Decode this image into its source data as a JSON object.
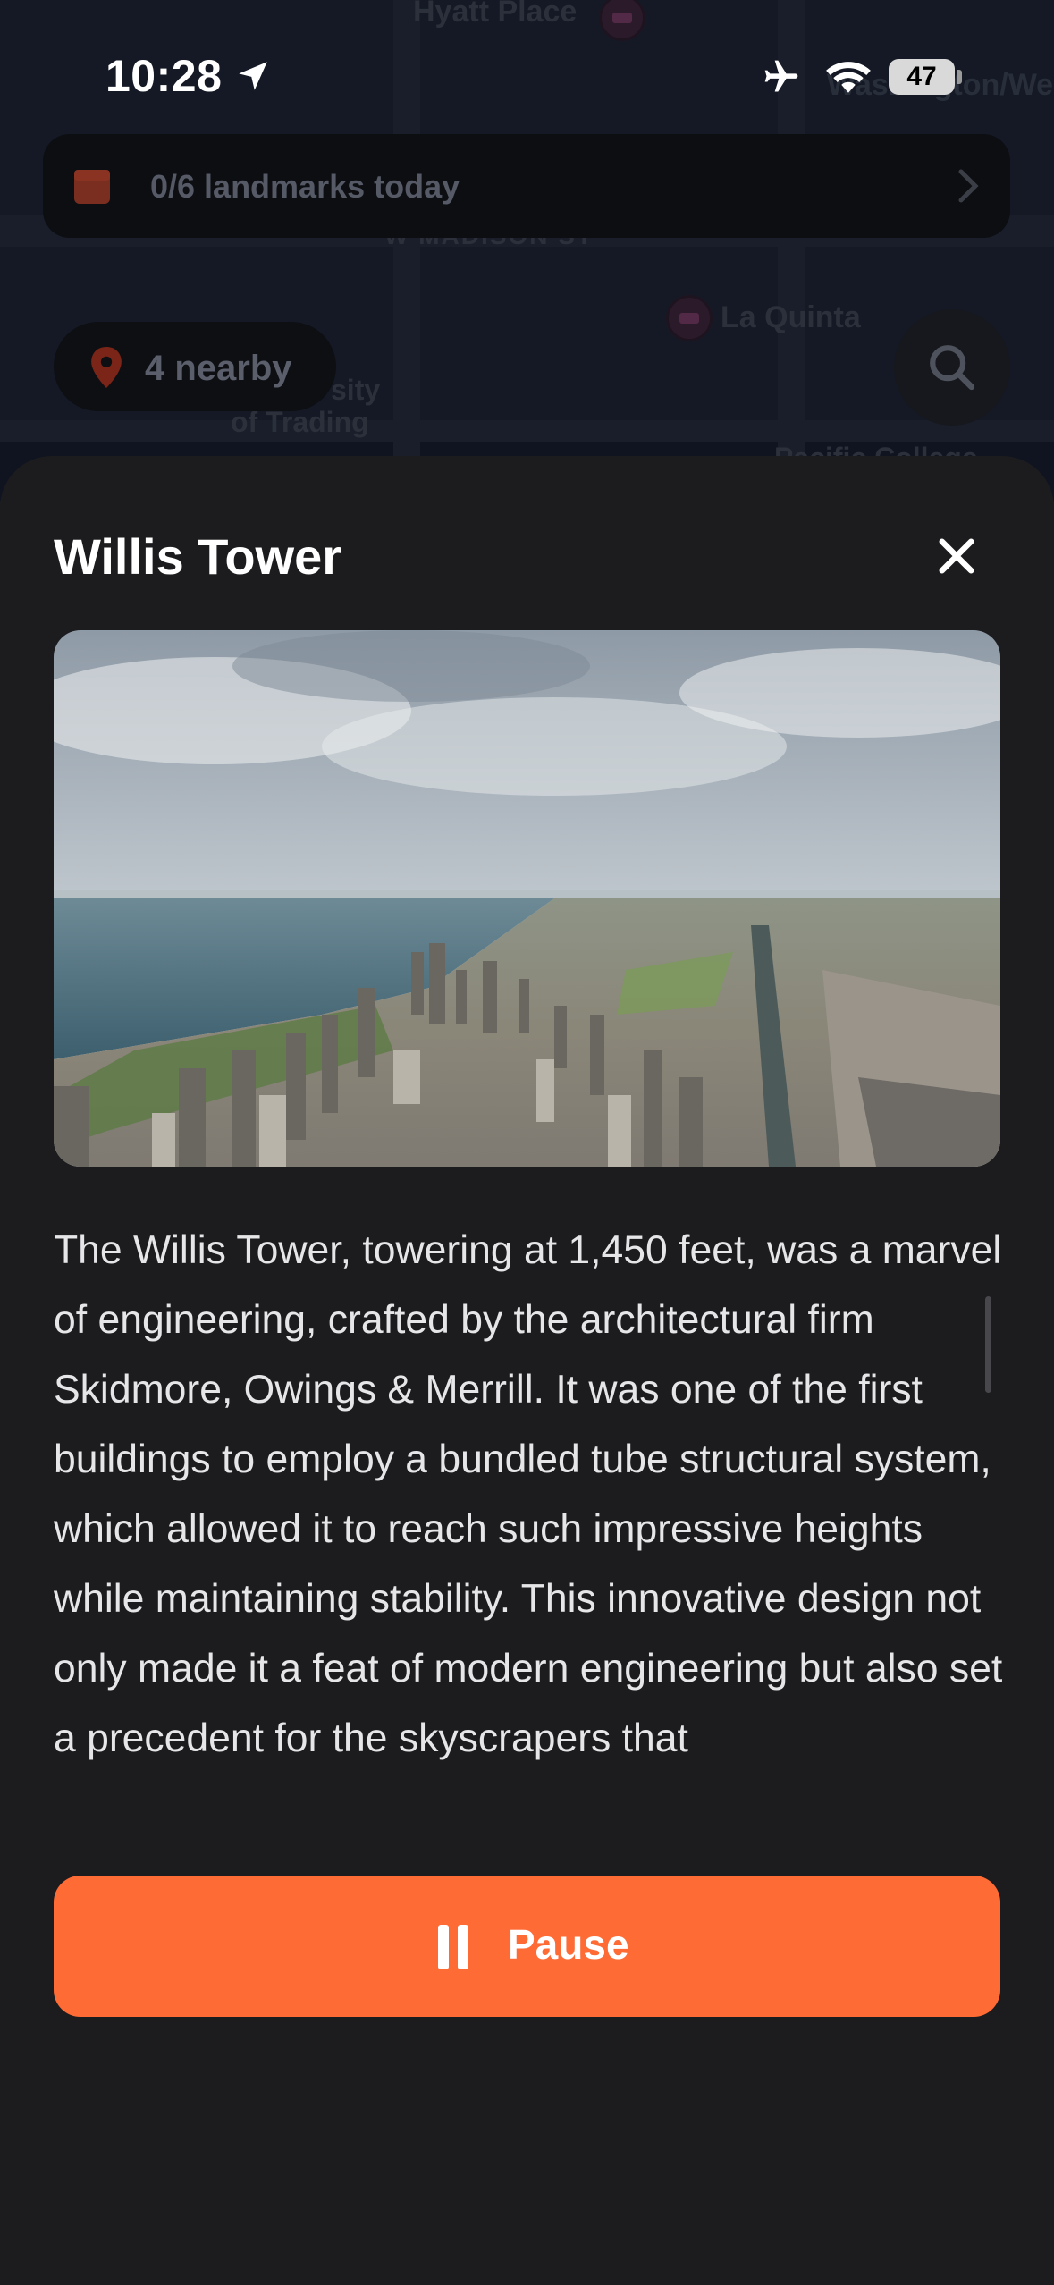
{
  "status_bar": {
    "time": "10:28",
    "battery": "47"
  },
  "map": {
    "labels": {
      "hyatt": "Hyatt Place",
      "washington": "Washington/We",
      "madison": "W MADISON ST",
      "la_quinta": "La Quinta",
      "university": "sity",
      "trading": "of Trading",
      "pacific": "Pacific College"
    }
  },
  "banner": {
    "text": "0/6 landmarks today",
    "icon": "calendar-icon"
  },
  "nearby": {
    "text": "4 nearby",
    "icon": "pin-icon"
  },
  "sheet": {
    "title": "Willis Tower",
    "description": "The Willis Tower, towering at 1,450 feet, was a marvel of engineering, crafted by the architectural firm Skidmore, Owings & Merrill. It was one of the first buildings to employ a bundled tube structural system, which allowed it to reach such impressive heights while maintaining stability. This innovative design not only made it a feat of modern engineering but also set a precedent for the skyscrapers that",
    "pause_label": "Pause"
  },
  "colors": {
    "accent": "#ff6b35",
    "sheet_bg": "#1c1c1e"
  }
}
